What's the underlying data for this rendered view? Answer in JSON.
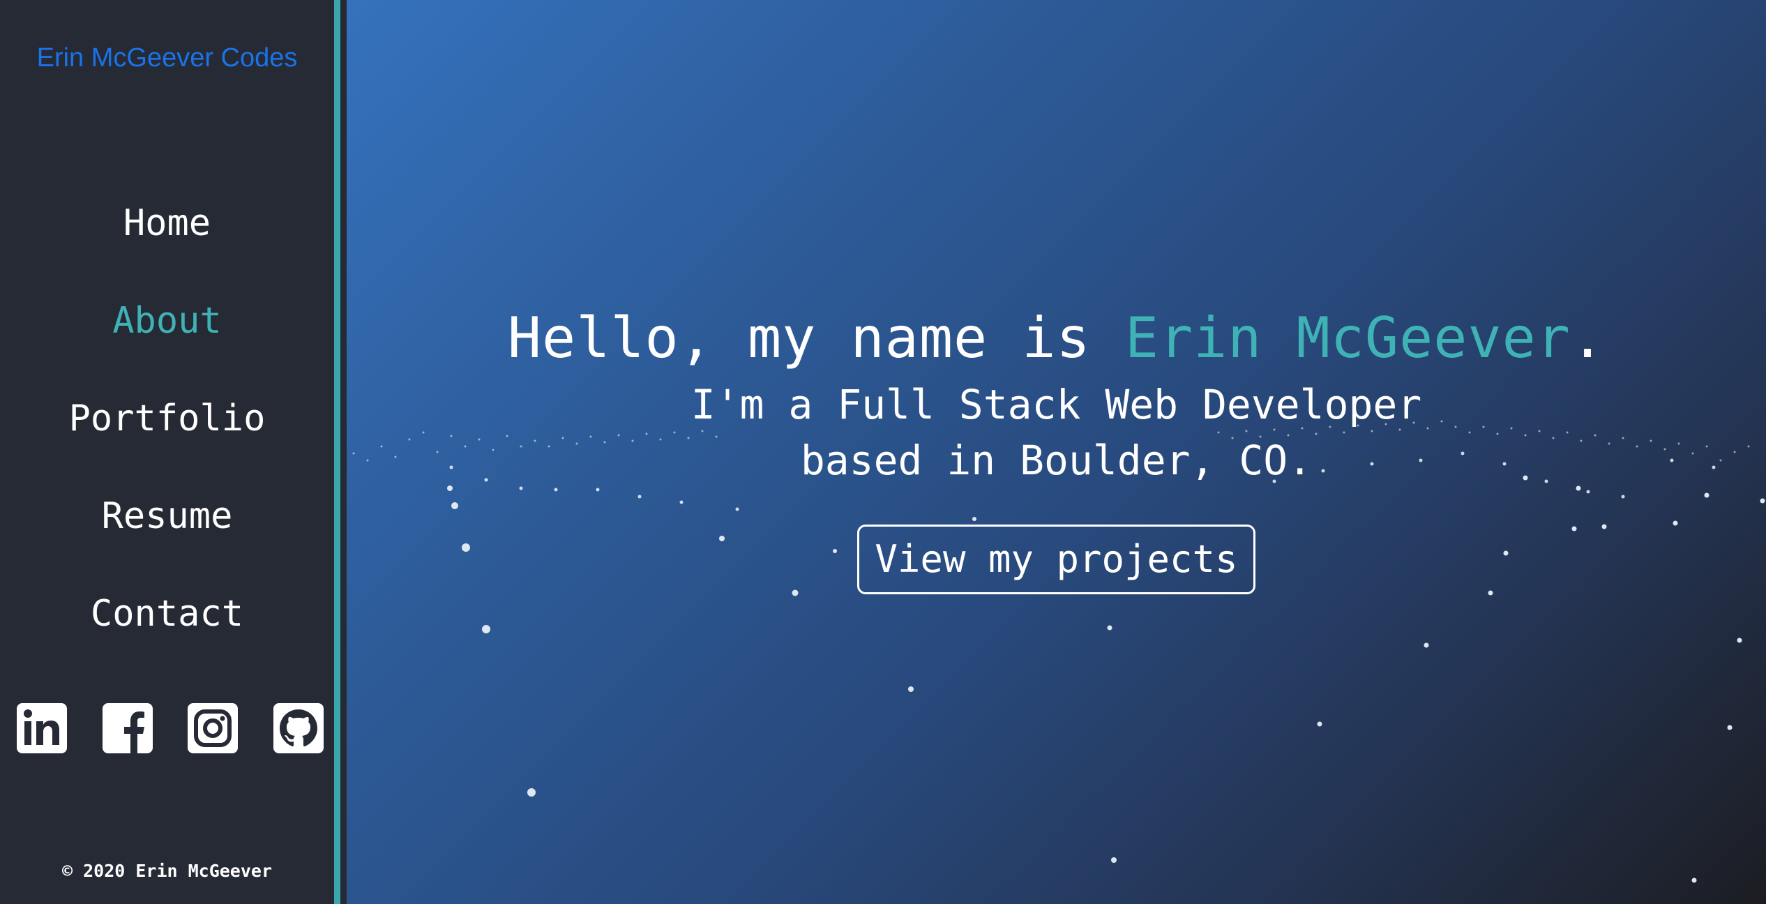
{
  "sidebar": {
    "brand": "Erin McGeever Codes",
    "nav": [
      {
        "label": "Home"
      },
      {
        "label": "About"
      },
      {
        "label": "Portfolio"
      },
      {
        "label": "Resume"
      },
      {
        "label": "Contact"
      }
    ],
    "active_nav": "About",
    "socials": [
      "linkedin-icon",
      "facebook-icon",
      "instagram-icon",
      "github-icon"
    ],
    "copyright": "© 2020 Erin McGeever"
  },
  "hero": {
    "greeting": "Hello, my name is ",
    "name": "Erin McGeever",
    "greeting_end": ".",
    "line1": "I'm a Full Stack Web Developer",
    "line2": "based in Boulder, CO.",
    "cta_label": "View my projects"
  },
  "colors": {
    "accent": "#3fb2b5",
    "brand_link": "#1a73e8",
    "sidebar_bg": "#262a35"
  }
}
